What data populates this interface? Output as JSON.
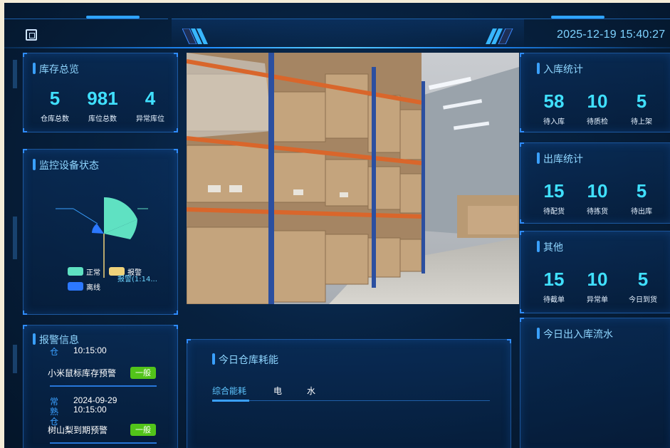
{
  "header": {
    "datetime": "2025-12-19 15:40:27"
  },
  "inventory_overview": {
    "title": "库存总览",
    "stats": [
      {
        "value": "5",
        "label": "仓库总数"
      },
      {
        "value": "981",
        "label": "库位总数"
      },
      {
        "value": "4",
        "label": "异常库位"
      }
    ]
  },
  "device_status": {
    "title": "监控设备状态",
    "legend": [
      {
        "label": "正常",
        "color": "#5fe1c2"
      },
      {
        "label": "报警",
        "color": "#f0d27a"
      },
      {
        "label": "离线",
        "color": "#2c78ff"
      }
    ],
    "tooltip_label": "报警(1:14..."
  },
  "alerts": {
    "title": "报警信息",
    "items": [
      {
        "category": "仓",
        "date": "",
        "time": "10:15:00",
        "message": "小米鼠标库存预警",
        "level": "一般"
      },
      {
        "category": "常熟仓",
        "date": "2024-09-29",
        "time": "10:15:00",
        "message": "树山梨到期预警",
        "level": "一般"
      }
    ]
  },
  "energy": {
    "title": "今日仓库耗能",
    "tabs": [
      "综合能耗",
      "电",
      "水"
    ],
    "active_tab": "综合能耗"
  },
  "inbound_stats": {
    "title": "入库统计",
    "stats": [
      {
        "value": "58",
        "label": "待入库"
      },
      {
        "value": "10",
        "label": "待质检"
      },
      {
        "value": "5",
        "label": "待上架"
      }
    ]
  },
  "outbound_stats": {
    "title": "出库统计",
    "stats": [
      {
        "value": "15",
        "label": "待配货"
      },
      {
        "value": "10",
        "label": "待拣货"
      },
      {
        "value": "5",
        "label": "待出库"
      }
    ]
  },
  "other_stats": {
    "title": "其他",
    "stats": [
      {
        "value": "15",
        "label": "待截单"
      },
      {
        "value": "10",
        "label": "异常单"
      },
      {
        "value": "5",
        "label": "今日到货"
      }
    ]
  },
  "daily_flow": {
    "title": "今日出入库流水"
  },
  "colors": {
    "accent": "#40e0ff",
    "title": "#8fd6ff",
    "badge_green": "#52c41a",
    "background": "#07213f"
  }
}
